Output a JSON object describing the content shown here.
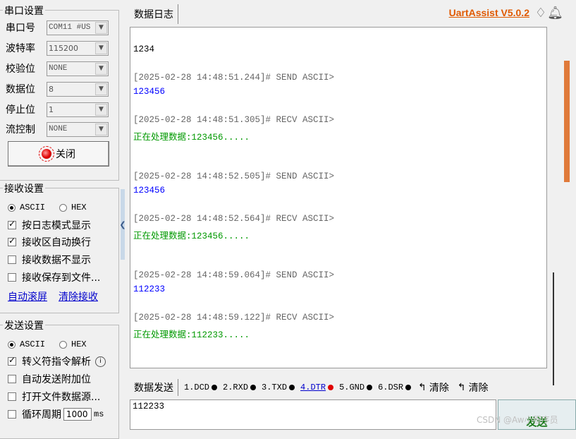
{
  "serial": {
    "group_title": "串口设置",
    "fields": [
      {
        "label": "串口号",
        "value": "COM11 #US"
      },
      {
        "label": "波特率",
        "value": "115200"
      },
      {
        "label": "校验位",
        "value": "NONE"
      },
      {
        "label": "数据位",
        "value": "8"
      },
      {
        "label": "停止位",
        "value": "1"
      },
      {
        "label": "流控制",
        "value": "NONE"
      }
    ],
    "close_label": "关闭"
  },
  "receive": {
    "group_title": "接收设置",
    "radio_ascii": "ASCII",
    "radio_hex": "HEX",
    "options": [
      {
        "label": "按日志模式显示",
        "checked": true
      },
      {
        "label": "接收区自动换行",
        "checked": true
      },
      {
        "label": "接收数据不显示",
        "checked": false
      },
      {
        "label": "接收保存到文件...",
        "checked": false
      }
    ],
    "link_autoscroll": "自动滚屏",
    "link_clear": "清除接收"
  },
  "send_settings": {
    "group_title": "发送设置",
    "radio_ascii": "ASCII",
    "radio_hex": "HEX",
    "options": [
      {
        "label": "转义符指令解析",
        "checked": true
      },
      {
        "label": "自动发送附加位",
        "checked": false
      },
      {
        "label": "打开文件数据源...",
        "checked": false
      },
      {
        "label": "循环周期",
        "checked": false
      }
    ],
    "period_value": "1000",
    "period_unit": "ms"
  },
  "header": {
    "tab_log": "数据日志",
    "brand": "UartAssist V5.0.2"
  },
  "log": [
    {
      "text": "1234",
      "kind": "sent"
    },
    {
      "text": "[2025-02-28 14:48:51.244]# SEND ASCII>",
      "kind": "ts"
    },
    {
      "text": "123456",
      "kind": "sent"
    },
    {
      "text": "[2025-02-28 14:48:51.305]# RECV ASCII>",
      "kind": "ts"
    },
    {
      "text": "正在处理数据:123456.....",
      "kind": "recv"
    },
    {
      "text": "[2025-02-28 14:48:52.505]# SEND ASCII>",
      "kind": "ts"
    },
    {
      "text": "123456",
      "kind": "sent"
    },
    {
      "text": "[2025-02-28 14:48:52.564]# RECV ASCII>",
      "kind": "ts"
    },
    {
      "text": "正在处理数据:123456.....",
      "kind": "recv"
    },
    {
      "text": "[2025-02-28 14:48:59.064]# SEND ASCII>",
      "kind": "ts"
    },
    {
      "text": "112233",
      "kind": "sent"
    },
    {
      "text": "[2025-02-28 14:48:59.122]# RECV ASCII>",
      "kind": "ts"
    },
    {
      "text": "正在处理数据:112233.....",
      "kind": "recv"
    }
  ],
  "sendbar": {
    "tab_send": "数据发送",
    "signals": [
      {
        "label": "1.DCD",
        "dot": "black"
      },
      {
        "label": "2.RXD",
        "dot": "black"
      },
      {
        "label": "3.TXD",
        "dot": "black"
      },
      {
        "label": "4.DTR",
        "dot": "red"
      },
      {
        "label": "5.GND",
        "dot": "black"
      },
      {
        "label": "6.DSR",
        "dot": "black"
      }
    ],
    "clear1": "清除",
    "clear2": "清除"
  },
  "send_input_value": "112233",
  "send_button": "发送",
  "watermark": "CSDN @Aw小程序员"
}
